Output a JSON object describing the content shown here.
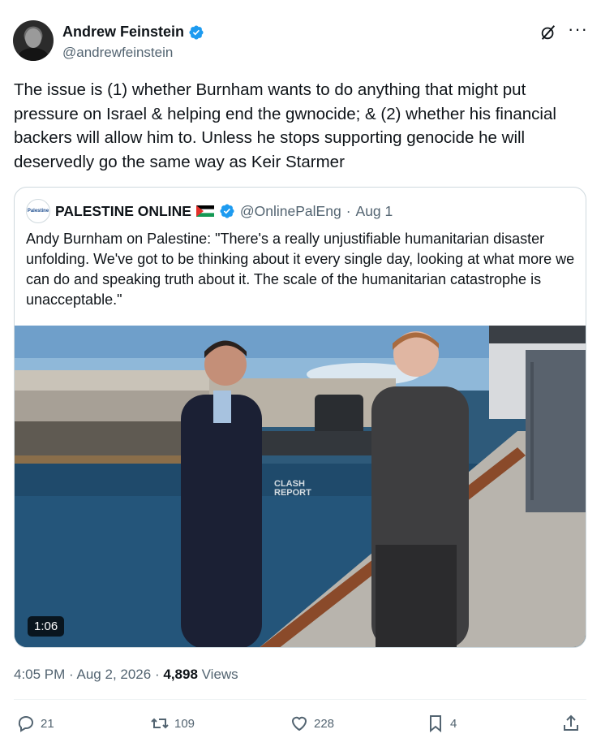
{
  "author": {
    "name": "Andrew Feinstein",
    "handle": "@andrewfeinstein"
  },
  "tweet": {
    "text": "The issue is (1) whether Burnham wants to do anything that might put pressure on Israel & helping end the gwnocide; & (2) whether his financial backers will allow him to. Unless he stops supporting genocide he will deservedly go the same way as Keir Starmer"
  },
  "quote": {
    "name": "PALESTINE ONLINE",
    "handle": "@OnlinePalEng",
    "separator": "·",
    "date": "Aug 1",
    "text": "Andy Burnham on Palestine: \"There's a really unjustifiable humanitarian disaster unfolding. We've got to be thinking about it every single day, looking at what more we can do and speaking truth about it. The scale of the humanitarian catastrophe is unacceptable.\"",
    "avatar_label": "Palestine",
    "video": {
      "duration": "1:06",
      "watermark_line1": "CLASH",
      "watermark_line2": "REPORT"
    }
  },
  "meta": {
    "time": "4:05 PM",
    "sep1": "·",
    "date": "Aug 2, 2026",
    "sep2": "·",
    "views_count": "4,898",
    "views_label": "Views"
  },
  "actions": {
    "replies": "21",
    "reposts": "109",
    "likes": "228",
    "bookmarks": "4"
  },
  "colors": {
    "verified": "#1d9bf0",
    "secondary_text": "#536471",
    "border": "#cfd9de"
  }
}
